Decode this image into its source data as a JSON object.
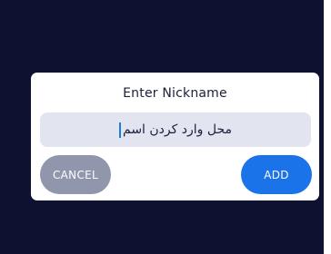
{
  "dialog": {
    "title": "Enter Nickname",
    "input_value": "محل وارد کردن اسم",
    "cancel_label": "CANCEL",
    "add_label": "ADD"
  },
  "colors": {
    "backdrop": "#0e1230",
    "input_background": "#e2e4ef",
    "cancel_button": "#9097ad",
    "add_button": "#1a73e8",
    "caret": "#1d7fd3"
  }
}
